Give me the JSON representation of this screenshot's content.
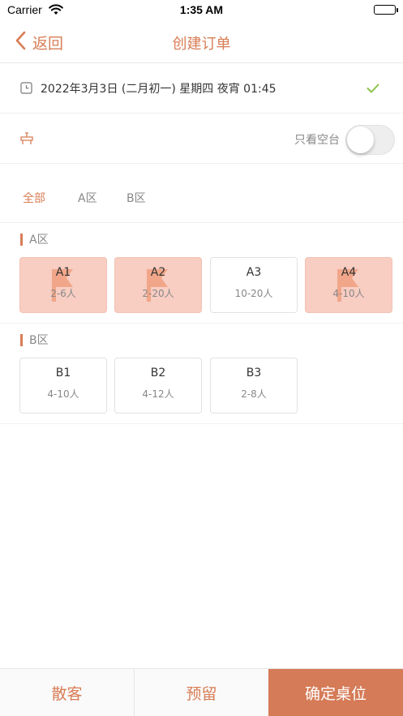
{
  "status_bar": {
    "carrier": "Carrier",
    "time": "1:35 AM"
  },
  "nav": {
    "back_label": "返回",
    "title": "创建订单"
  },
  "booking": {
    "datetime": "2022年3月3日 (二月初一) 星期四 夜宵 01:45"
  },
  "filter": {
    "empty_only_label": "只看空台",
    "empty_only_on": false
  },
  "tabs": [
    {
      "label": "全部",
      "active": true
    },
    {
      "label": "A区",
      "active": false
    },
    {
      "label": "B区",
      "active": false
    }
  ],
  "sections": [
    {
      "name": "A区",
      "tables": [
        {
          "name": "A1",
          "capacity": "2-6人",
          "occupied": true
        },
        {
          "name": "A2",
          "capacity": "2-20人",
          "occupied": true
        },
        {
          "name": "A3",
          "capacity": "10-20人",
          "occupied": false
        },
        {
          "name": "A4",
          "capacity": "4-10人",
          "occupied": true
        }
      ]
    },
    {
      "name": "B区",
      "tables": [
        {
          "name": "B1",
          "capacity": "4-10人",
          "occupied": false
        },
        {
          "name": "B2",
          "capacity": "4-12人",
          "occupied": false
        },
        {
          "name": "B3",
          "capacity": "2-8人",
          "occupied": false
        }
      ]
    }
  ],
  "bottom": {
    "walkin_label": "散客",
    "reserve_label": "预留",
    "confirm_label": "确定桌位"
  },
  "colors": {
    "accent": "#d87d55",
    "occupied_bg": "#f8cdc2",
    "check": "#8bc34a"
  }
}
